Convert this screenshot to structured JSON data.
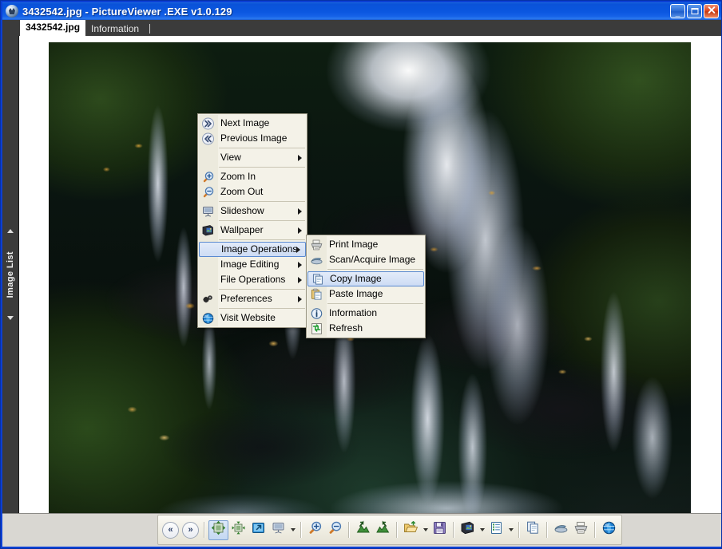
{
  "window": {
    "title": "3432542.jpg - PictureViewer .EXE v1.0.129",
    "app_icon": "picture-viewer-icon",
    "buttons": {
      "minimize": "_",
      "maximize": "",
      "close": "✕"
    }
  },
  "tabs": [
    {
      "label": "3432542.jpg",
      "active": true
    },
    {
      "label": "Information",
      "active": false
    }
  ],
  "sidebar": {
    "label": "Image List",
    "arrow_up": "up-arrow-icon",
    "arrow_down": "down-arrow-icon"
  },
  "photo": {
    "alt": "Waterfall cascading over dark mossy rocks"
  },
  "context_menu": {
    "items": [
      {
        "label": "Next Image",
        "icon": "next-image-icon",
        "submenu": false,
        "separator_after": false
      },
      {
        "label": "Previous Image",
        "icon": "previous-image-icon",
        "submenu": false,
        "separator_after": true
      },
      {
        "label": "View",
        "icon": "",
        "submenu": true,
        "separator_after": true
      },
      {
        "label": "Zoom In",
        "icon": "zoom-in-icon",
        "submenu": false,
        "separator_after": false
      },
      {
        "label": "Zoom Out",
        "icon": "zoom-out-icon",
        "submenu": false,
        "separator_after": true
      },
      {
        "label": "Slideshow",
        "icon": "slideshow-icon",
        "submenu": true,
        "separator_after": true
      },
      {
        "label": "Wallpaper",
        "icon": "wallpaper-icon",
        "submenu": true,
        "separator_after": true
      },
      {
        "label": "Image Operations",
        "icon": "",
        "submenu": true,
        "separator_after": false,
        "selected": true
      },
      {
        "label": "Image Editing",
        "icon": "",
        "submenu": true,
        "separator_after": false
      },
      {
        "label": "File Operations",
        "icon": "",
        "submenu": true,
        "separator_after": true
      },
      {
        "label": "Preferences",
        "icon": "preferences-icon",
        "submenu": true,
        "separator_after": true
      },
      {
        "label": "Visit Website",
        "icon": "globe-icon",
        "submenu": false,
        "separator_after": false
      }
    ]
  },
  "submenu": {
    "items": [
      {
        "label": "Print Image",
        "icon": "printer-icon",
        "separator_after": false
      },
      {
        "label": "Scan/Acquire Image",
        "icon": "scanner-icon",
        "separator_after": true
      },
      {
        "label": "Copy Image",
        "icon": "copy-icon",
        "separator_after": false,
        "selected": true
      },
      {
        "label": "Paste Image",
        "icon": "paste-icon",
        "separator_after": true
      },
      {
        "label": "Information",
        "icon": "info-icon",
        "separator_after": false
      },
      {
        "label": "Refresh",
        "icon": "refresh-icon",
        "separator_after": false
      }
    ]
  },
  "toolbar": {
    "items": [
      {
        "name": "previous-image-button",
        "icon": "double-chevron-left-icon",
        "type": "round",
        "glyph": "«"
      },
      {
        "name": "next-image-button",
        "icon": "double-chevron-right-icon",
        "type": "round",
        "glyph": "»"
      },
      {
        "name": "separator-1",
        "type": "separator"
      },
      {
        "name": "fit-to-window-button",
        "icon": "fit-to-window-icon",
        "type": "icon",
        "pressed": true
      },
      {
        "name": "actual-size-button",
        "icon": "actual-size-icon",
        "type": "icon"
      },
      {
        "name": "full-screen-button",
        "icon": "full-screen-icon",
        "type": "icon"
      },
      {
        "name": "slideshow-button",
        "icon": "slideshow-icon",
        "type": "icon"
      },
      {
        "name": "slideshow-dropdown",
        "icon": "chevron-down-icon",
        "type": "dropdown"
      },
      {
        "name": "separator-2",
        "type": "separator"
      },
      {
        "name": "zoom-in-button",
        "icon": "zoom-in-icon",
        "type": "icon"
      },
      {
        "name": "zoom-out-button",
        "icon": "zoom-out-icon",
        "type": "icon"
      },
      {
        "name": "separator-3",
        "type": "separator"
      },
      {
        "name": "rotate-left-button",
        "icon": "rotate-left-icon",
        "type": "icon"
      },
      {
        "name": "rotate-right-button",
        "icon": "rotate-right-icon",
        "type": "icon"
      },
      {
        "name": "separator-4",
        "type": "separator"
      },
      {
        "name": "open-file-button",
        "icon": "open-folder-icon",
        "type": "icon"
      },
      {
        "name": "open-file-dropdown",
        "icon": "chevron-down-icon",
        "type": "dropdown"
      },
      {
        "name": "save-button",
        "icon": "floppy-disk-icon",
        "type": "icon"
      },
      {
        "name": "separator-5",
        "type": "separator"
      },
      {
        "name": "wallpaper-button",
        "icon": "wallpaper-icon",
        "type": "icon"
      },
      {
        "name": "wallpaper-dropdown",
        "icon": "chevron-down-icon",
        "type": "dropdown"
      },
      {
        "name": "image-list-button",
        "icon": "list-icon",
        "type": "icon"
      },
      {
        "name": "image-list-dropdown",
        "icon": "chevron-down-icon",
        "type": "dropdown"
      },
      {
        "name": "separator-6",
        "type": "separator"
      },
      {
        "name": "copy-button",
        "icon": "copy-icon",
        "type": "icon"
      },
      {
        "name": "separator-7",
        "type": "separator"
      },
      {
        "name": "scan-button",
        "icon": "scanner-icon",
        "type": "icon"
      },
      {
        "name": "print-button",
        "icon": "printer-icon",
        "type": "icon"
      },
      {
        "name": "separator-8",
        "type": "separator"
      },
      {
        "name": "visit-website-button",
        "icon": "globe-icon",
        "type": "icon"
      }
    ]
  },
  "colors": {
    "title_bar": "#0b55dd",
    "window_frame": "#0b3fd4",
    "menu_bg": "#f4f2e8",
    "menu_highlight": "#cddcf4",
    "tab_strip": "#3b3b3b",
    "toolbar_bg": "#f0eee3"
  }
}
